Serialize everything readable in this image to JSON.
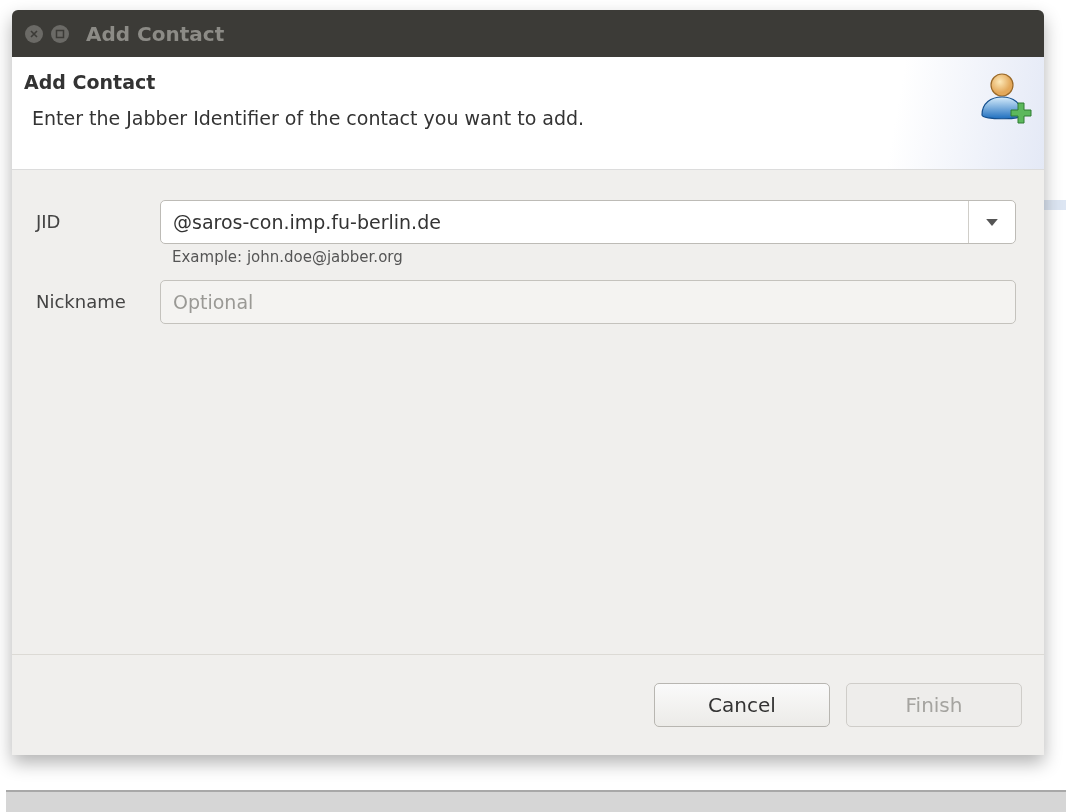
{
  "window": {
    "title": "Add Contact"
  },
  "header": {
    "title": "Add Contact",
    "message": "Enter the Jabber Identifier of the contact you want to add."
  },
  "fields": [
    {
      "label": "JID",
      "kind": "combo",
      "value": "@saros-con.imp.fu-berlin.de",
      "hint": "Example: john.doe@jabber.org"
    },
    {
      "label": "Nickname",
      "kind": "text",
      "placeholder": "Optional"
    }
  ],
  "buttons": [
    {
      "label": "Cancel",
      "disabled": false
    },
    {
      "label": "Finish",
      "disabled": true
    }
  ]
}
